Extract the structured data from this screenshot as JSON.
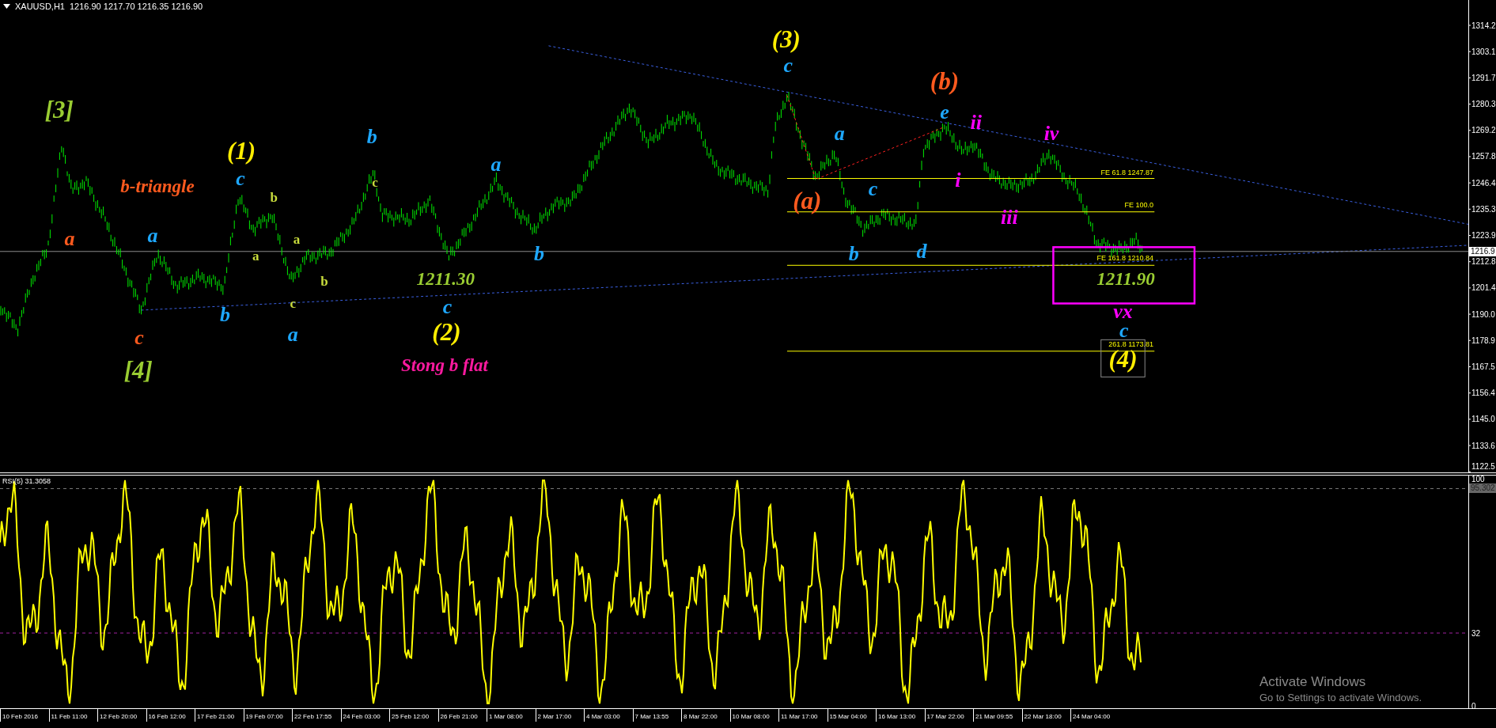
{
  "header": {
    "symbol": "XAUUSD,H1",
    "ohlc": "1216.90 1217.70 1216.35 1216.90"
  },
  "price_axis": {
    "ticks": [
      "1314.2",
      "1303.1",
      "1291.7",
      "1280.3",
      "1269.2",
      "1257.8",
      "1246.4",
      "1235.3",
      "1223.9",
      "1212.8",
      "1201.4",
      "1190.0",
      "1178.9",
      "1167.5",
      "1156.4",
      "1145.0",
      "1133.6",
      "1122.5"
    ],
    "current_price": "1216.9"
  },
  "fib_levels": [
    {
      "label": "FE 61.8 1247.87"
    },
    {
      "label": "FE 100.0"
    },
    {
      "label": "FE 161.8 1210.84"
    },
    {
      "label": "261.8 1173.81"
    }
  ],
  "wave_labels": [
    {
      "text": "[3]",
      "color": "#9acd32",
      "kind": "degree"
    },
    {
      "text": "b-triangle",
      "color": "#ff5a1e",
      "kind": "note"
    },
    {
      "text": "a",
      "color": "#ff5a1e",
      "kind": "wave"
    },
    {
      "text": "c",
      "color": "#ff5a1e",
      "kind": "wave"
    },
    {
      "text": "[4]",
      "color": "#9acd32",
      "kind": "degree"
    },
    {
      "text": "a",
      "color": "#1ea8ff",
      "kind": "wave"
    },
    {
      "text": "b",
      "color": "#1ea8ff",
      "kind": "wave"
    },
    {
      "text": "a",
      "color": "#1ea8ff",
      "kind": "wave"
    },
    {
      "text": "(1)",
      "color": "#ffee00",
      "kind": "degree"
    },
    {
      "text": "c",
      "color": "#1ea8ff",
      "kind": "wave"
    },
    {
      "text": "b",
      "color": "#c8dc3c",
      "kind": "minor"
    },
    {
      "text": "a",
      "color": "#c8dc3c",
      "kind": "minor"
    },
    {
      "text": "a",
      "color": "#c8dc3c",
      "kind": "minor"
    },
    {
      "text": "c",
      "color": "#c8dc3c",
      "kind": "minor"
    },
    {
      "text": "b",
      "color": "#c8dc3c",
      "kind": "minor"
    },
    {
      "text": "b",
      "color": "#1ea8ff",
      "kind": "wave"
    },
    {
      "text": "c",
      "color": "#c8dc3c",
      "kind": "minor"
    },
    {
      "text": "1211.30",
      "color": "#9acd32",
      "kind": "note"
    },
    {
      "text": "c",
      "color": "#1ea8ff",
      "kind": "wave"
    },
    {
      "text": "(2)",
      "color": "#ffee00",
      "kind": "degree"
    },
    {
      "text": "Stong b flat",
      "color": "#ff1aa0",
      "kind": "note"
    },
    {
      "text": "a",
      "color": "#1ea8ff",
      "kind": "wave"
    },
    {
      "text": "b",
      "color": "#1ea8ff",
      "kind": "wave"
    },
    {
      "text": "(3)",
      "color": "#ffee00",
      "kind": "degree"
    },
    {
      "text": "c",
      "color": "#1ea8ff",
      "kind": "wave"
    },
    {
      "text": "a",
      "color": "#1ea8ff",
      "kind": "wave"
    },
    {
      "text": "(a)",
      "color": "#ff5a1e",
      "kind": "degree"
    },
    {
      "text": "c",
      "color": "#1ea8ff",
      "kind": "wave"
    },
    {
      "text": "b",
      "color": "#1ea8ff",
      "kind": "wave"
    },
    {
      "text": "d",
      "color": "#1ea8ff",
      "kind": "wave"
    },
    {
      "text": "(b)",
      "color": "#ff5a1e",
      "kind": "degree"
    },
    {
      "text": "e",
      "color": "#1ea8ff",
      "kind": "wave"
    },
    {
      "text": "ii",
      "color": "#ff00ff",
      "kind": "wave"
    },
    {
      "text": "i",
      "color": "#ff00ff",
      "kind": "wave"
    },
    {
      "text": "iii",
      "color": "#ff00ff",
      "kind": "wave"
    },
    {
      "text": "iv",
      "color": "#ff00ff",
      "kind": "wave"
    },
    {
      "text": "1211.90",
      "color": "#9acd32",
      "kind": "note"
    },
    {
      "text": "vx",
      "color": "#ff00ff",
      "kind": "wave"
    },
    {
      "text": "c",
      "color": "#1ea8ff",
      "kind": "wave"
    },
    {
      "text": "(4)",
      "color": "#ffee00",
      "kind": "degree"
    }
  ],
  "rsi": {
    "label": "RSI(5) 31.3058",
    "ticks": [
      "100",
      "95.302",
      "32",
      "0"
    ]
  },
  "time_axis": [
    "10 Feb 2016",
    "11 Feb 11:00",
    "12 Feb 20:00",
    "16 Feb 12:00",
    "17 Feb 21:00",
    "19 Feb 07:00",
    "22 Feb 17:55",
    "24 Feb 03:00",
    "25 Feb 12:00",
    "26 Feb 21:00",
    "1 Mar 08:00",
    "2 Mar 17:00",
    "4 Mar 03:00",
    "7 Mar 13:55",
    "8 Mar 22:00",
    "10 Mar 08:00",
    "11 Mar 17:00",
    "15 Mar 04:00",
    "16 Mar 13:00",
    "17 Mar 22:00",
    "21 Mar 09:55",
    "22 Mar 18:00",
    "24 Mar 04:00"
  ],
  "activation_notice": {
    "title": "Activate Windows",
    "hint": "Go to Settings to activate Windows."
  }
}
